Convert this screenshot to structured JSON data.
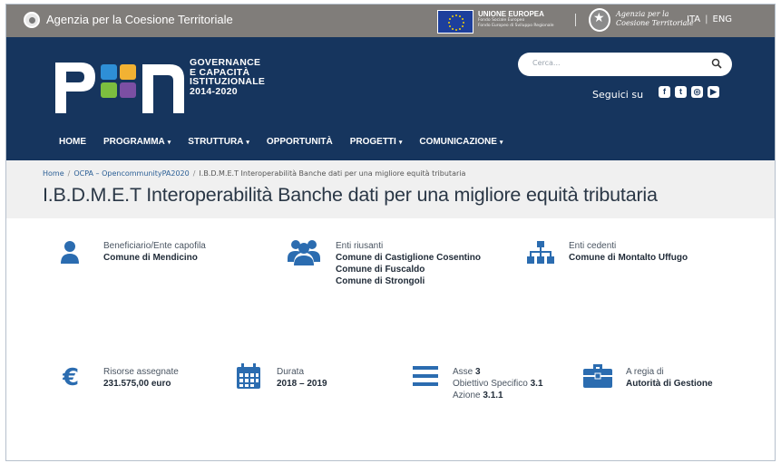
{
  "topbar": {
    "agency_name": "Agenzia per la Coesione Territoriale",
    "eu_title": "UNIONE EUROPEA",
    "eu_sub1": "Fondo Sociale Europeo",
    "eu_sub2": "Fondo Europeo di Sviluppo Regionale",
    "agency_script_1": "Agenzia per la",
    "agency_script_2": "Coesione Territoriale",
    "lang_ita": "ITA",
    "lang_sep": "|",
    "lang_eng": "ENG"
  },
  "header": {
    "logo_text": [
      "GOVERNANCE",
      "E CAPACITÀ",
      "ISTITUZIONALE",
      "2014-2020"
    ],
    "search_placeholder": "Cerca...",
    "follow_label": "Seguici su",
    "socials": [
      "facebook-icon",
      "twitter-icon",
      "instagram-icon",
      "youtube-icon"
    ],
    "nav": [
      {
        "label": "HOME",
        "caret": ""
      },
      {
        "label": "PROGRAMMA",
        "caret": "▾"
      },
      {
        "label": "STRUTTURA",
        "caret": "▾"
      },
      {
        "label": "OPPORTUNITÀ",
        "caret": ""
      },
      {
        "label": "PROGETTI",
        "caret": "▾"
      },
      {
        "label": "COMUNICAZIONE",
        "caret": "▾"
      }
    ]
  },
  "breadcrumb": [
    "Home",
    "OCPA – OpencommunityPA2020",
    "I.B.D.M.E.T Interoperabilità Banche dati per una migliore equità tributaria"
  ],
  "breadcrumb_sep": "/",
  "page_title": "I.B.D.M.E.T Interoperabilità Banche dati per una migliore equità tributaria",
  "info": {
    "beneficiario_label": "Beneficiario/Ente capofila",
    "beneficiario_value": "Comune di Mendicino",
    "riusanti_label": "Enti riusanti",
    "riusanti_values": [
      "Comune di Castiglione Cosentino",
      "Comune di Fuscaldo",
      "Comune di Strongoli"
    ],
    "cedenti_label": "Enti cedenti",
    "cedenti_value": "Comune di Montalto Uffugo",
    "risorse_label": "Risorse assegnate",
    "risorse_value": "231.575,00 euro",
    "durata_label": "Durata",
    "durata_value": "2018 – 2019",
    "asse_label": "Asse",
    "asse_value": "3",
    "obiettivo_label": "Obiettivo Specifico",
    "obiettivo_value": "3.1",
    "azione_label": "Azione",
    "azione_value": "3.1.1",
    "regia_label": "A regia di",
    "regia_value": "Autorità di Gestione"
  },
  "colors": {
    "header_blue": "#16355e",
    "icon_blue": "#2b6cb0",
    "topbar_grey": "#807d7a",
    "band_grey": "#f0f0f0"
  }
}
